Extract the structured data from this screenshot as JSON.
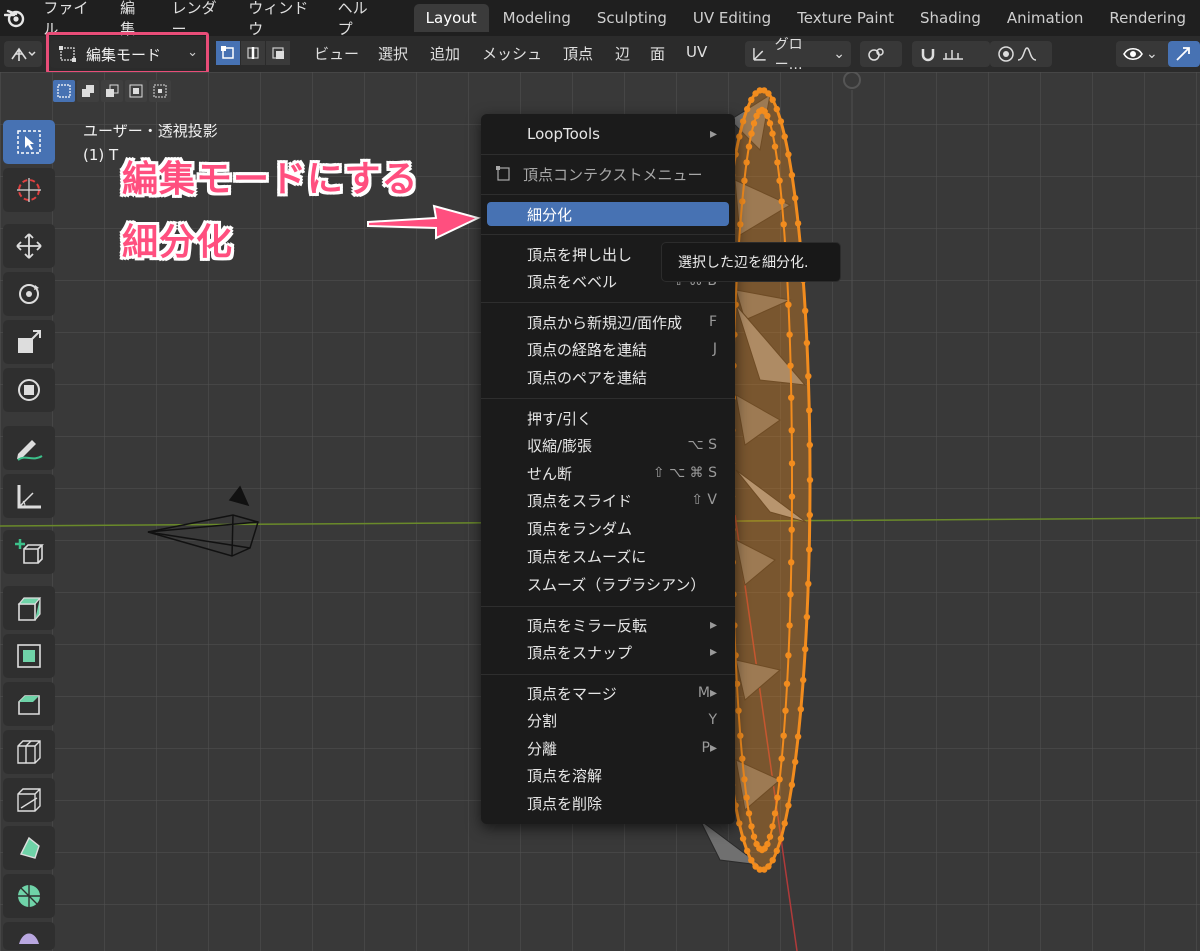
{
  "menubar": {
    "items": [
      "ファイル",
      "編集",
      "レンダー",
      "ウィンドウ",
      "ヘルプ"
    ],
    "workspaces": [
      "Layout",
      "Modeling",
      "Sculpting",
      "UV Editing",
      "Texture Paint",
      "Shading",
      "Animation",
      "Rendering"
    ],
    "active_workspace": "Layout"
  },
  "header": {
    "mode_label": "編集モード",
    "menus": [
      "ビュー",
      "選択",
      "追加",
      "メッシュ",
      "頂点",
      "辺",
      "面",
      "UV"
    ],
    "transform_orientation": "グロー…"
  },
  "viewport": {
    "view_name": "ユーザー・透視投影",
    "object_name": "(1) T"
  },
  "annotation": {
    "line1": "編集モードにする",
    "line2": "細分化",
    "color": "#ff4f7f"
  },
  "context_menu": {
    "loop_tools": "LoopTools",
    "title": "頂点コンテクストメニュー",
    "highlighted": "細分化",
    "group1": [
      {
        "label": "頂点を押し出し",
        "shortcut": ""
      },
      {
        "label": "頂点をベベル",
        "shortcut": "⇧ ⌘ B"
      }
    ],
    "group2": [
      {
        "label": "頂点から新規辺/面作成",
        "shortcut": "F"
      },
      {
        "label": "頂点の経路を連結",
        "shortcut": "J"
      },
      {
        "label": "頂点のペアを連結",
        "shortcut": ""
      }
    ],
    "group3": [
      {
        "label": "押す/引く",
        "shortcut": ""
      },
      {
        "label": "収縮/膨張",
        "shortcut": "⌥ S"
      },
      {
        "label": "せん断",
        "shortcut": "⇧ ⌥ ⌘ S"
      },
      {
        "label": "頂点をスライド",
        "shortcut": "⇧ V"
      },
      {
        "label": "頂点をランダム",
        "shortcut": ""
      },
      {
        "label": "頂点をスムーズに",
        "shortcut": ""
      },
      {
        "label": "スムーズ（ラプラシアン）",
        "shortcut": ""
      }
    ],
    "group4": [
      {
        "label": "頂点をミラー反転",
        "shortcut": "▸"
      },
      {
        "label": "頂点をスナップ",
        "shortcut": "▸"
      }
    ],
    "group5": [
      {
        "label": "頂点をマージ",
        "shortcut": "M▸"
      },
      {
        "label": "分割",
        "shortcut": "Y"
      },
      {
        "label": "分離",
        "shortcut": "P▸"
      },
      {
        "label": "頂点を溶解",
        "shortcut": ""
      },
      {
        "label": "頂点を削除",
        "shortcut": ""
      }
    ]
  },
  "tooltip": {
    "text": "選択した辺を細分化."
  },
  "colors": {
    "accent_blue": "#4772b3",
    "mesh_orange": "#f28c1e",
    "highlight_box": "#e84d78"
  }
}
